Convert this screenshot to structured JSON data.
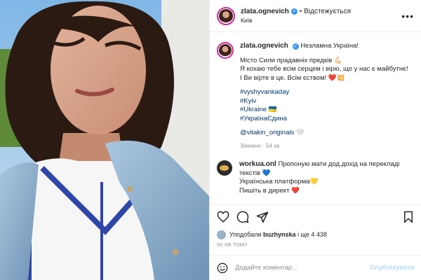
{
  "post": {
    "username": "zlata.ognevich",
    "follow_state": "Відстежується",
    "dot": "•",
    "location": "Київ",
    "caption": {
      "head": "Незламна Україна!",
      "line1": "Місто Сили прадавніх предків 💪🏻",
      "line2": "Я кохаю тебе всім серцем і вірю, що у нас є майбутнє!",
      "line3": "І Ви вірте в це. Всім єством! ❤️💥",
      "tags": [
        "#vyshyvankaday",
        "#Kyiv",
        "#Ukraine 🇺🇦",
        "#УкраїнаЄдина"
      ],
      "mention": "@vitakin_originals",
      "mention_suffix": "🤍"
    },
    "edited": "Змінено · 54 хв"
  },
  "comment": {
    "username": "workua.onl",
    "line1": "Пропоную мати дод.дохід на перекладі текстів 💙",
    "line2": "Українська платформа💛",
    "line3": "Пишіть в директ ❤️"
  },
  "likes": {
    "prefix": "Уподобали",
    "user": "buzhynska",
    "suffix": "і ще 4 438"
  },
  "time_ago": "56 ХВ ТОМУ",
  "comment_box": {
    "placeholder": "Додайте коментар...",
    "publish": "Опублікувати"
  },
  "icons": [
    "heart-icon",
    "comment-icon",
    "share-icon",
    "bookmark-icon",
    "emoji-icon",
    "more-icon",
    "verified-icon"
  ],
  "colors": {
    "link": "#00376b",
    "verified": "#3897f0",
    "publish_disabled": "#b3dbff"
  }
}
